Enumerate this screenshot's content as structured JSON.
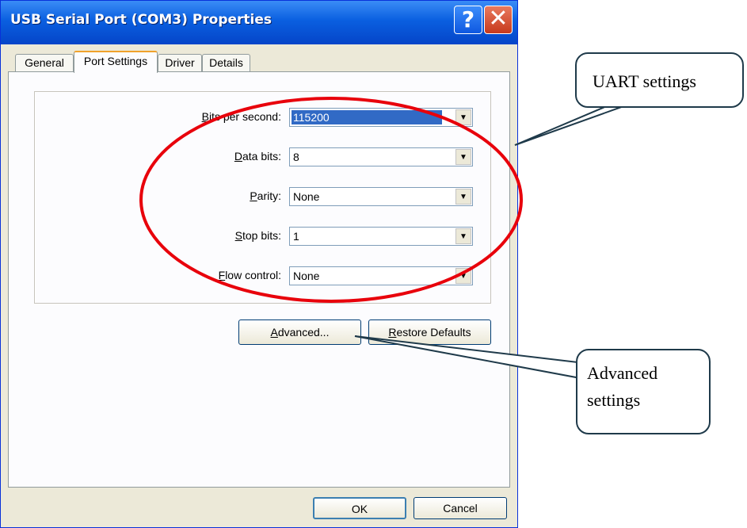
{
  "window": {
    "title": "USB Serial Port (COM3) Properties",
    "help_label": "?",
    "close_label": "✕"
  },
  "tabs": [
    {
      "label": "General",
      "active": false
    },
    {
      "label": "Port Settings",
      "active": true
    },
    {
      "label": "Driver",
      "active": false
    },
    {
      "label": "Details",
      "active": false
    }
  ],
  "port_settings": {
    "bits_per_second": {
      "label_prefix": "B",
      "label_rest": "its per second:",
      "value": "115200"
    },
    "data_bits": {
      "label_prefix": "D",
      "label_rest": "ata bits:",
      "value": "8"
    },
    "parity": {
      "label_prefix": "P",
      "label_rest": "arity:",
      "value": "None"
    },
    "stop_bits": {
      "label_prefix": "S",
      "label_rest": "top bits:",
      "value": "1"
    },
    "flow_control": {
      "label_prefix": "F",
      "label_rest": "low control:",
      "value": "None"
    }
  },
  "buttons": {
    "advanced_prefix": "A",
    "advanced_rest": "dvanced...",
    "restore_prefix": "R",
    "restore_rest": "estore Defaults",
    "ok": "OK",
    "cancel": "Cancel"
  },
  "callouts": {
    "uart": "UART settings",
    "advanced_line1": "Advanced",
    "advanced_line2": "settings"
  },
  "colors": {
    "titlebar": "#0a5fe0",
    "selection": "#316ac5",
    "annotation_ellipse": "#e8000b",
    "callout_border": "#1f3a4a"
  }
}
